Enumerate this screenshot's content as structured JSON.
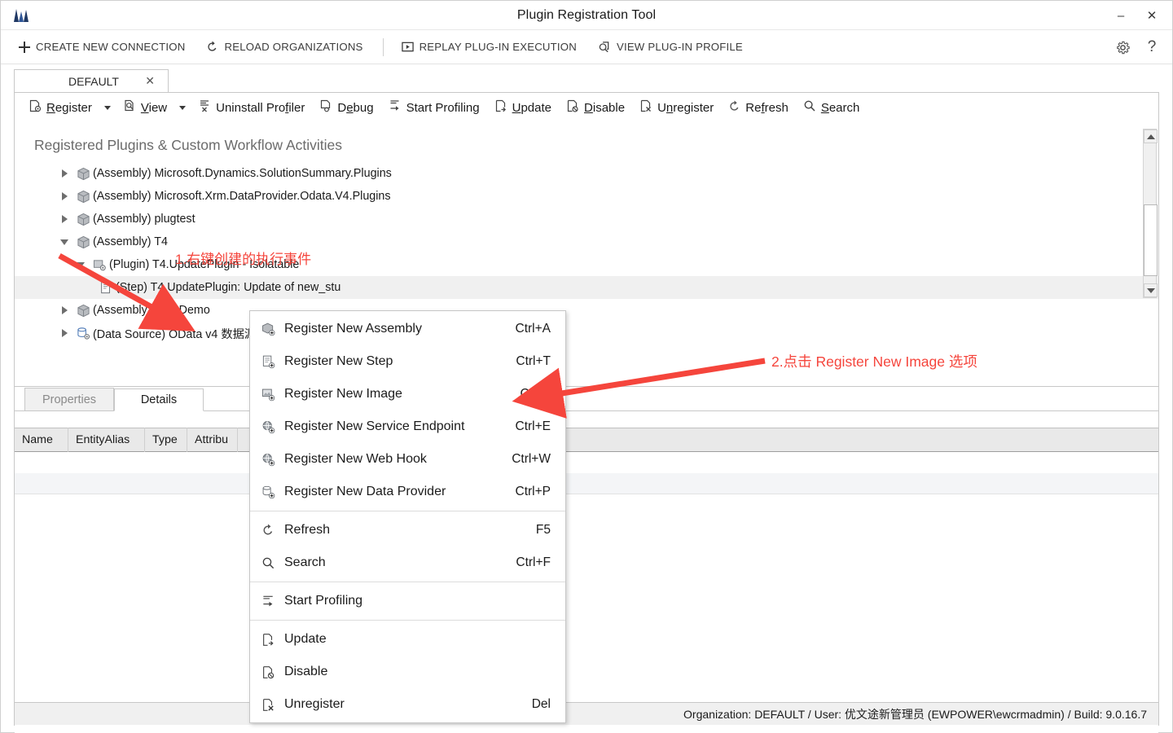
{
  "window": {
    "title": "Plugin Registration Tool",
    "logo_icon": "app-logo-icon",
    "minimize_label": "–",
    "close_label": "✕"
  },
  "commandbar": {
    "items": [
      {
        "label": "CREATE NEW CONNECTION",
        "icon": "plus-icon"
      },
      {
        "label": "RELOAD ORGANIZATIONS",
        "icon": "refresh-icon"
      },
      {
        "label": "REPLAY PLUG-IN EXECUTION",
        "icon": "play-box-icon"
      },
      {
        "label": "VIEW PLUG-IN PROFILE",
        "icon": "profile-icon"
      }
    ],
    "settings_icon": "gear-icon",
    "help_icon": "question-icon"
  },
  "tabs": [
    {
      "label": "DEFAULT",
      "close": "✕",
      "active": true
    }
  ],
  "ribbon": {
    "items": [
      {
        "label": "Register",
        "mnemonic": "R",
        "icon": "register-icon",
        "has_caret": true
      },
      {
        "label": "View",
        "mnemonic": "V",
        "icon": "view-icon",
        "has_caret": true
      },
      {
        "label": "Uninstall Profiler",
        "mnemonic": "f",
        "icon": "uninstall-profiler-icon",
        "has_caret": false
      },
      {
        "label": "Debug",
        "mnemonic": "e",
        "icon": "debug-icon",
        "has_caret": false
      },
      {
        "label": "Start Profiling",
        "mnemonic": "",
        "icon": "start-profiling-icon",
        "has_caret": false
      },
      {
        "label": "Update",
        "mnemonic": "U",
        "icon": "update-icon",
        "has_caret": false
      },
      {
        "label": "Disable",
        "mnemonic": "D",
        "icon": "disable-icon",
        "has_caret": false
      },
      {
        "label": "Unregister",
        "mnemonic": "n",
        "icon": "unregister-icon",
        "has_caret": false
      },
      {
        "label": "Refresh",
        "mnemonic": "f",
        "icon": "refresh-icon",
        "has_caret": false
      },
      {
        "label": "Search",
        "mnemonic": "S",
        "icon": "search-icon",
        "has_caret": false
      }
    ]
  },
  "tree": {
    "heading": "Registered Plugins & Custom Workflow Activities",
    "nodes": [
      {
        "label": "(Assembly) Microsoft.Dynamics.SolutionSummary.Plugins",
        "icon": "assembly-icon",
        "indent": 0,
        "state": "collapsed",
        "selected": false
      },
      {
        "label": "(Assembly) Microsoft.Xrm.DataProvider.Odata.V4.Plugins",
        "icon": "assembly-icon",
        "indent": 0,
        "state": "collapsed",
        "selected": false
      },
      {
        "label": "(Assembly) plugtest",
        "icon": "assembly-icon",
        "indent": 0,
        "state": "collapsed",
        "selected": false
      },
      {
        "label": "(Assembly) T4",
        "icon": "assembly-icon",
        "indent": 0,
        "state": "expanded",
        "selected": false
      },
      {
        "label": "(Plugin) T4.UpdatePlugin - Isolatable",
        "icon": "plugin-icon",
        "indent": 1,
        "state": "expanded",
        "selected": false
      },
      {
        "label": "(Step) T4.UpdatePlugin: Update of new_stu",
        "icon": "step-icon",
        "indent": 2,
        "state": "leaf",
        "selected": true
      },
      {
        "label": "(Assembly) WF_Demo",
        "icon": "assembly-icon",
        "indent": 0,
        "state": "collapsed",
        "selected": false
      },
      {
        "label": "(Data Source) OData v4 数据源",
        "icon": "datasource-icon",
        "indent": 0,
        "state": "collapsed",
        "selected": false
      }
    ],
    "scrollbar": {
      "up": "scroll-up-arrow",
      "down": "scroll-down-arrow"
    }
  },
  "bottom_panel": {
    "tabs": [
      {
        "label": "Properties",
        "active": false
      },
      {
        "label": "Details",
        "active": true
      }
    ],
    "columns": [
      "Name",
      "EntityAlias",
      "Type",
      "Attribu"
    ],
    "rows": []
  },
  "context_menu": {
    "groups": [
      {
        "items": [
          {
            "label": "Register New Assembly",
            "shortcut": "Ctrl+A",
            "icon": "register-assembly-icon"
          },
          {
            "label": "Register New Step",
            "shortcut": "Ctrl+T",
            "icon": "register-step-icon"
          },
          {
            "label": "Register New Image",
            "shortcut": "Ctrl+I",
            "icon": "register-image-icon"
          },
          {
            "label": "Register New Service Endpoint",
            "shortcut": "Ctrl+E",
            "icon": "register-service-endpoint-icon"
          },
          {
            "label": "Register New Web Hook",
            "shortcut": "Ctrl+W",
            "icon": "register-webhook-icon"
          },
          {
            "label": "Register New Data Provider",
            "shortcut": "Ctrl+P",
            "icon": "register-data-provider-icon"
          }
        ]
      },
      {
        "items": [
          {
            "label": "Refresh",
            "shortcut": "F5",
            "icon": "refresh-icon"
          },
          {
            "label": "Search",
            "shortcut": "Ctrl+F",
            "icon": "search-icon"
          }
        ]
      },
      {
        "items": [
          {
            "label": "Start Profiling",
            "shortcut": "",
            "icon": "start-profiling-icon"
          }
        ]
      },
      {
        "items": [
          {
            "label": "Update",
            "shortcut": "",
            "icon": "update-icon"
          },
          {
            "label": "Disable",
            "shortcut": "",
            "icon": "disable-icon"
          },
          {
            "label": "Unregister",
            "shortcut": "Del",
            "icon": "unregister-icon"
          }
        ]
      }
    ]
  },
  "annotations": [
    {
      "text": "1.右键创建的执行事件",
      "color": "#f5453c"
    },
    {
      "text": "2.点击 Register New Image 选项",
      "color": "#f5453c"
    }
  ],
  "statusbar": {
    "text": "Organization: DEFAULT / User: 优文途新管理员 (EWPOWER\\ewcrmadmin) / Build: 9.0.16.7"
  },
  "colors": {
    "accent": "#f5453c",
    "selection": "#f0f0f0",
    "grid_header": "#e9e9e9"
  }
}
